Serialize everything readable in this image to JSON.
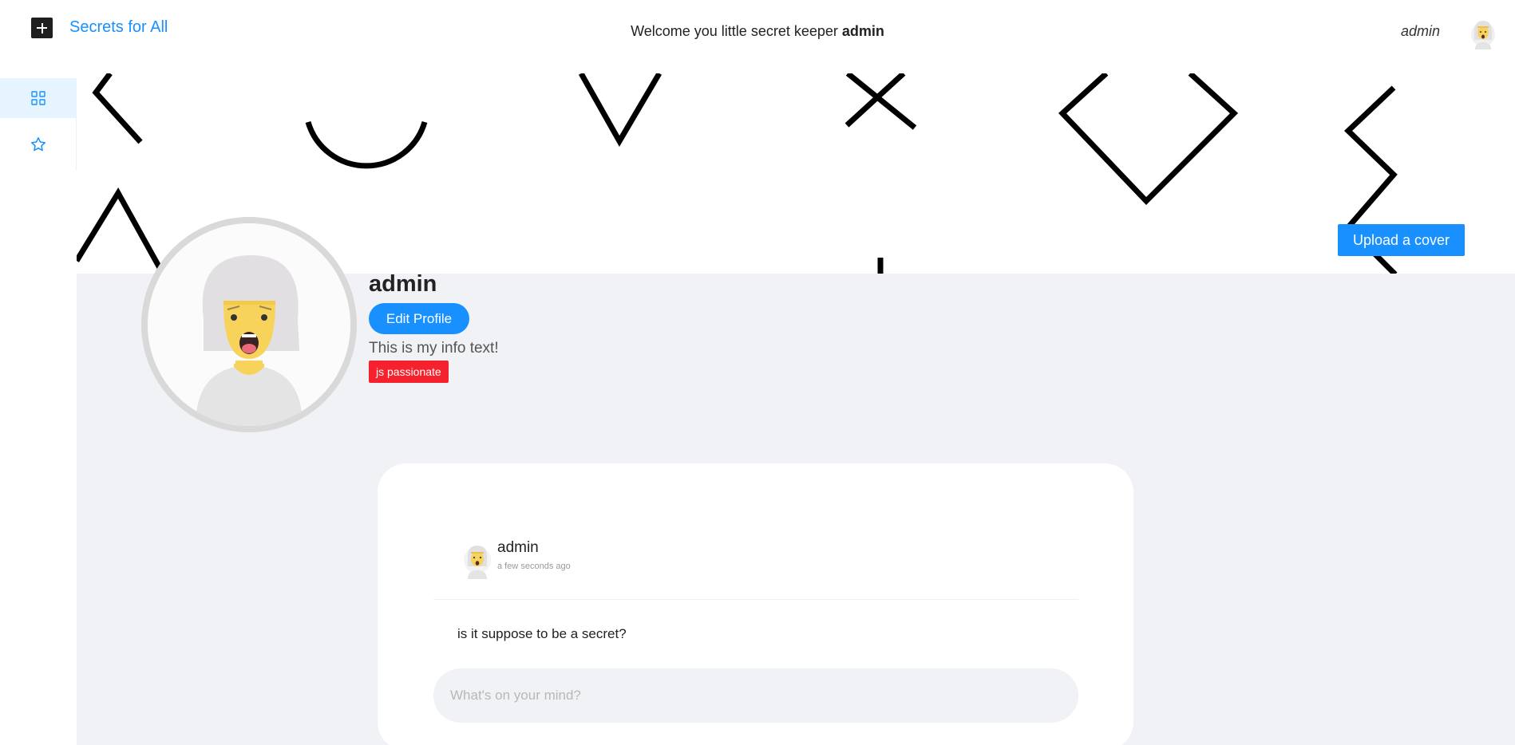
{
  "header": {
    "app_title": "Secrets for All",
    "welcome_prefix": "Welcome you little secret keeper ",
    "welcome_user": "admin",
    "user_name": "admin"
  },
  "sidebar": {
    "items": [
      {
        "icon": "grid-icon",
        "active": true
      },
      {
        "icon": "star-icon",
        "active": false
      }
    ]
  },
  "cover": {
    "upload_label": "Upload a cover"
  },
  "profile": {
    "name": "admin",
    "edit_label": "Edit Profile",
    "info_text": "This is my info text!",
    "tag": "js passionate"
  },
  "post": {
    "author": "admin",
    "time": "a few seconds ago",
    "body": "is it suppose to be a secret?",
    "input_placeholder": "What's on your mind?"
  },
  "colors": {
    "accent": "#1890ff",
    "tag": "#f5222d",
    "background": "#f0f2f5"
  }
}
